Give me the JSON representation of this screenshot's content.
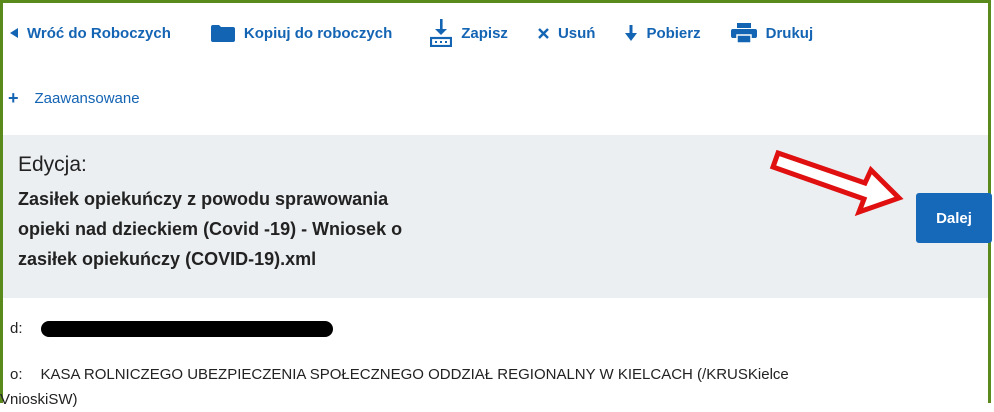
{
  "toolbar": {
    "back_label": "Wróć do Roboczych",
    "copy_label": "Kopiuj do roboczych",
    "save_label": "Zapisz",
    "delete_label": "Usuń",
    "download_label": "Pobierz",
    "print_label": "Drukuj"
  },
  "advanced": {
    "label": "Zaawansowane"
  },
  "edit": {
    "heading": "Edycja:",
    "file_line1": "Zasiłek opiekuńczy z powodu sprawowania",
    "file_line2": "opieki nad dzieckiem (Covid -19) - Wniosek o",
    "file_line3": "zasiłek opiekuńczy (COVID-19).xml",
    "next_label": "Dalej"
  },
  "fields": {
    "from_label": "d:",
    "to_label": "o:",
    "to_line1": "KASA ROLNICZEGO UBEZPIECZENIA SPOŁECZNEGO ODDZIAŁ REGIONALNY W KIELCACH (/KRUSKielce",
    "to_line2": "VnioskiSW)"
  },
  "colors": {
    "accent": "#1464b4",
    "button": "#1668b8",
    "panel": "#eceff2",
    "frame": "#5a8a1c",
    "annotation": "#e01010"
  }
}
